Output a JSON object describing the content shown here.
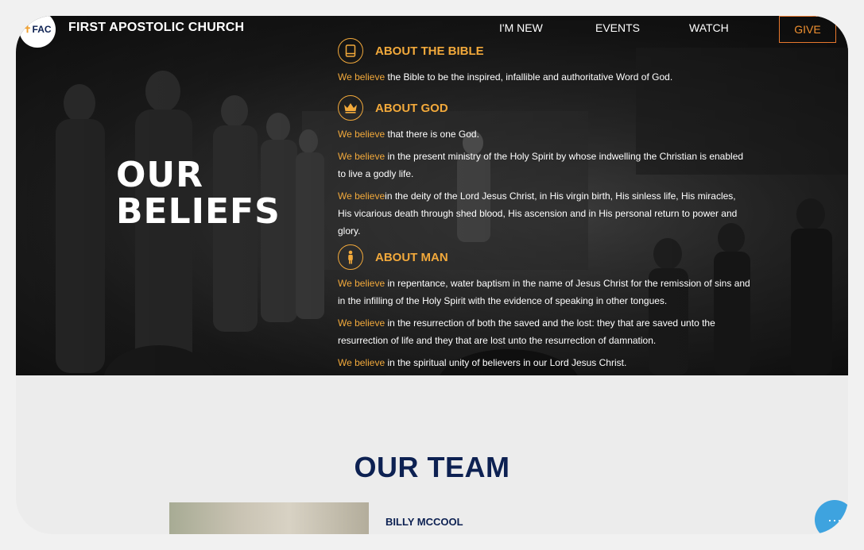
{
  "header": {
    "logo_text": "FAC",
    "brand": "FIRST APOSTOLIC CHURCH",
    "nav": [
      "I'M NEW",
      "EVENTS",
      "WATCH"
    ],
    "give": "GIVE"
  },
  "hero": {
    "title_line1": "OUR",
    "title_line2": "BELIEFS",
    "sections": [
      {
        "title": "ABOUT THE BIBLE",
        "icon": "book-icon",
        "beliefs": [
          {
            "lead": "We believe",
            "text": " the Bible to be the inspired, infallible and authoritative Word of God."
          }
        ]
      },
      {
        "title": "ABOUT GOD",
        "icon": "crown-icon",
        "beliefs": [
          {
            "lead": "We believe",
            "text": " that there is one God."
          },
          {
            "lead": "We believe",
            "text": " in the present ministry of the Holy Spirit by whose indwelling the Christian is enabled to live a godly life."
          },
          {
            "lead": "We believe",
            "text": "in the deity of the Lord Jesus Christ, in His virgin birth, His sinless life, His miracles, His vicarious death through shed blood, His ascension and in His personal return to power and glory."
          }
        ]
      },
      {
        "title": "ABOUT MAN",
        "icon": "person-icon",
        "beliefs": [
          {
            "lead": "We believe",
            "text": " in repentance, water baptism in the name of Jesus Christ for the remission of sins and in the infilling of the Holy Spirit with the evidence of speaking in other tongues."
          },
          {
            "lead": "We believe",
            "text": " in the resurrection of both the saved and the lost: they that are saved unto the resurrection of life and they that are lost unto the resurrection of damnation."
          },
          {
            "lead": "We believe",
            "text": " in the spiritual unity of believers in our Lord Jesus Christ."
          }
        ]
      }
    ]
  },
  "team": {
    "title": "OUR TEAM",
    "members": [
      {
        "name": "BILLY MCCOOL"
      }
    ]
  },
  "chat": {
    "label": "···"
  },
  "colors": {
    "accent": "#f2a93b",
    "navy": "#0d2152",
    "give_border": "#e8782d",
    "chat": "#3ea3df"
  }
}
